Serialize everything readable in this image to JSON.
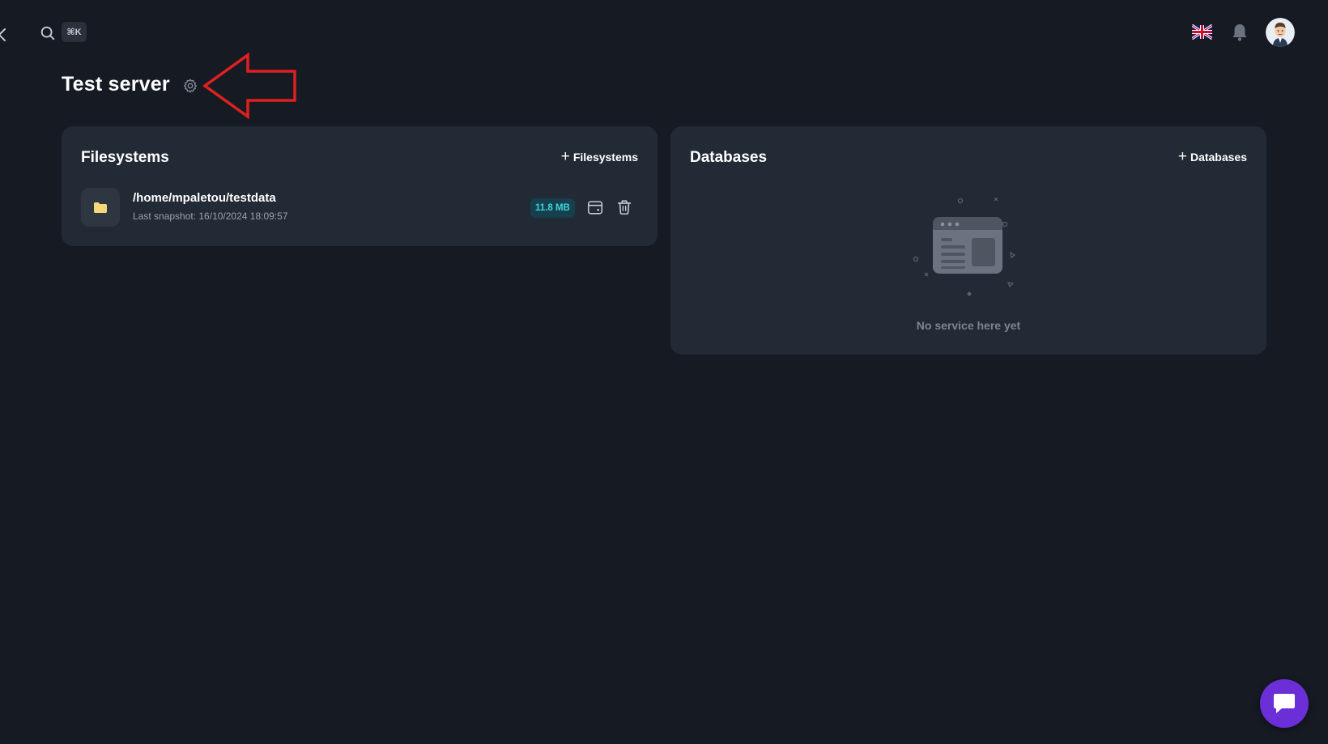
{
  "topbar": {
    "search_shortcut": "⌘K"
  },
  "page": {
    "title": "Test server"
  },
  "filesystems": {
    "title": "Filesystems",
    "add_label": "Filesystems",
    "items": [
      {
        "path": "/home/mpaletou/testdata",
        "snapshot": "Last snapshot: 16/10/2024 18:09:57",
        "size": "11.8 MB"
      }
    ]
  },
  "databases": {
    "title": "Databases",
    "add_label": "Databases",
    "empty_text": "No service here yet"
  },
  "colors": {
    "background": "#151a23",
    "card": "#222a35",
    "badge_bg": "#16404b",
    "badge_text": "#3fd3e0",
    "chat_button": "#6a2fd6",
    "annotation": "#e02020",
    "folder": "#f5d77a"
  },
  "icons": {
    "collapse": "chevron-left-icon",
    "search": "search-icon",
    "flag": "uk-flag-icon",
    "notifications": "bell-icon",
    "settings": "gear-icon",
    "folder": "folder-icon",
    "schedule": "calendar-icon",
    "delete": "trash-icon",
    "chat": "chat-icon"
  }
}
